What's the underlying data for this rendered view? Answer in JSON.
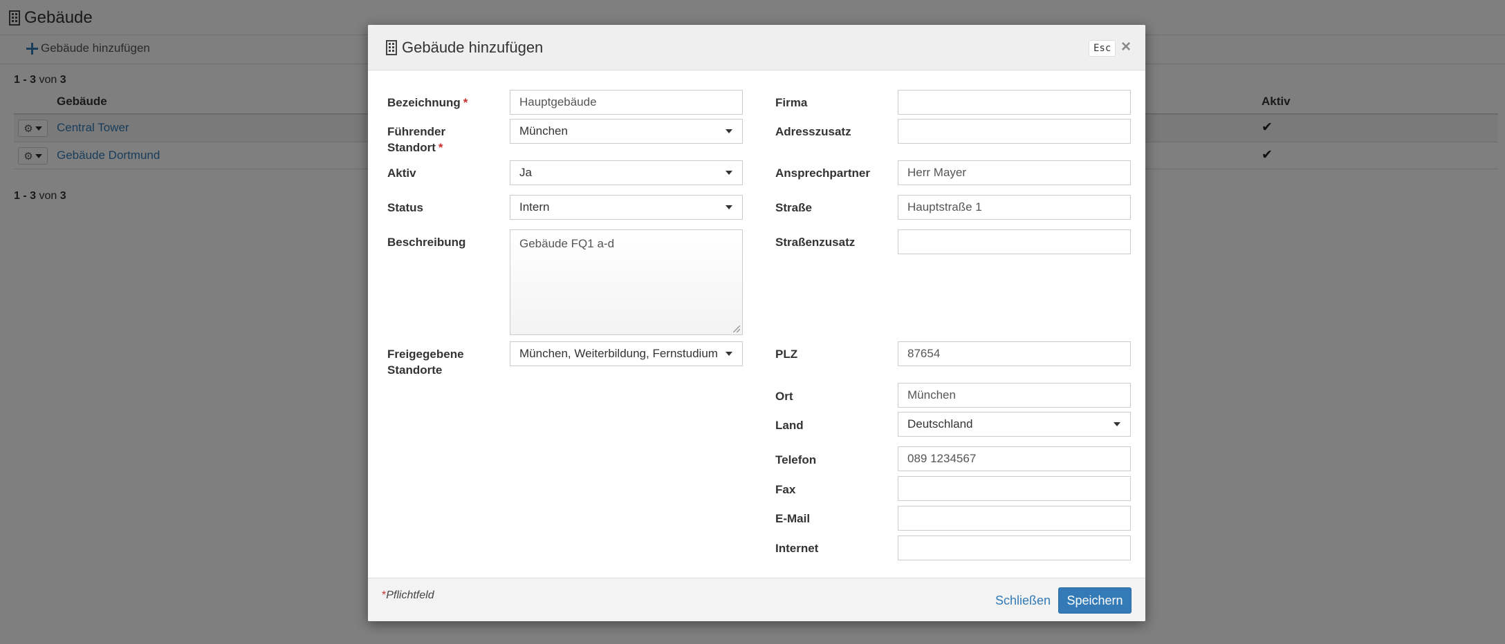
{
  "page": {
    "title": "Gebäude",
    "add_label": "Gebäude hinzufügen",
    "pager_top": {
      "from": "1",
      "sep": " - ",
      "to": "3",
      "of": "von",
      "total": "3"
    },
    "pager_bottom": {
      "from": "1",
      "sep": " - ",
      "to": "3",
      "of": "von",
      "total": "3"
    },
    "columns": {
      "name": "Gebäude",
      "active": "Aktiv"
    },
    "rows": [
      {
        "name": "Central Tower",
        "active_icon": "check-icon"
      },
      {
        "name": "Gebäude Dortmund",
        "active_icon": "check-icon"
      }
    ],
    "check_glyph": "✔"
  },
  "modal": {
    "title": "Gebäude hinzufügen",
    "esc": "Esc",
    "close": "×",
    "left": {
      "bezeichnung": {
        "label": "Bezeichnung",
        "value": "Hauptgebäude",
        "required": "*"
      },
      "standort": {
        "label_line1": "Führender",
        "label_line2": "Standort",
        "value": "München",
        "required": "*"
      },
      "aktiv": {
        "label": "Aktiv",
        "value": "Ja"
      },
      "status": {
        "label": "Status",
        "value": "Intern"
      },
      "beschreibung": {
        "label": "Beschreibung",
        "value": "Gebäude FQ1 a-d"
      },
      "freigegeben": {
        "label_line1": "Freigegebene",
        "label_line2": "Standorte",
        "value": "München, Weiterbildung, Fernstudium"
      }
    },
    "right": {
      "firma": {
        "label": "Firma",
        "value": ""
      },
      "adresszusatz": {
        "label": "Adresszusatz",
        "value": ""
      },
      "ansprechpartner": {
        "label": "Ansprechpartner",
        "value": "Herr Mayer"
      },
      "strasse": {
        "label": "Straße",
        "value": "Hauptstraße 1"
      },
      "strassenzusatz": {
        "label": "Straßenzusatz",
        "value": ""
      },
      "plz": {
        "label": "PLZ",
        "value": "87654"
      },
      "ort": {
        "label": "Ort",
        "value": "München"
      },
      "land": {
        "label": "Land",
        "value": "Deutschland"
      },
      "telefon": {
        "label": "Telefon",
        "value": "089 1234567"
      },
      "fax": {
        "label": "Fax",
        "value": ""
      },
      "email": {
        "label": "E-Mail",
        "value": ""
      },
      "internet": {
        "label": "Internet",
        "value": ""
      }
    },
    "footer": {
      "hint_star": "*",
      "hint_text": "Pflichtfeld",
      "close_label": "Schließen",
      "save_label": "Speichern"
    }
  },
  "colors": {
    "primary": "#337ab7",
    "required": "#c9302c",
    "backdrop": "rgba(0,0,0,0.5)"
  }
}
